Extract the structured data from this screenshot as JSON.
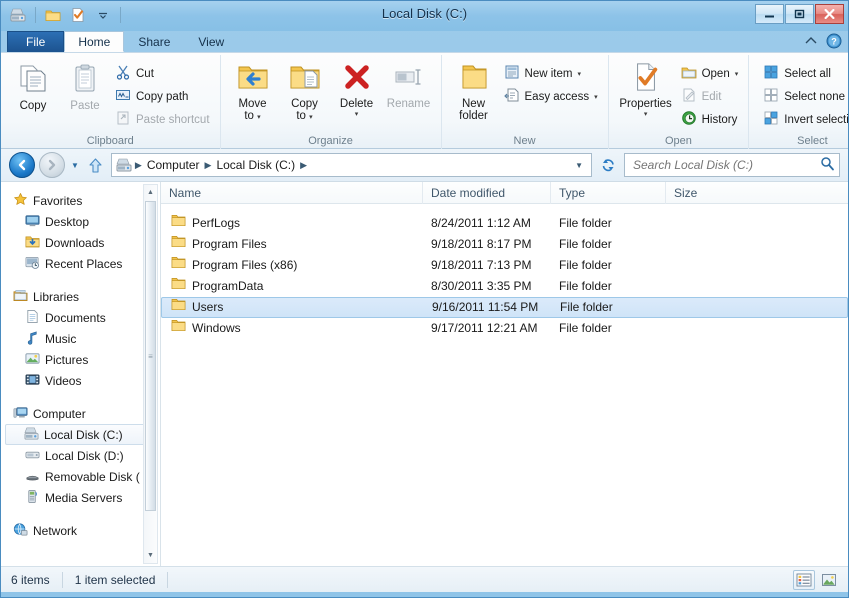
{
  "window": {
    "title": "Local Disk (C:)",
    "controls": {
      "minimize": "–",
      "restore": "❐",
      "close": "✕"
    },
    "quick_access": [
      "drive-icon",
      "folder-icon",
      "properties-icon",
      "customize-dropdown-icon"
    ]
  },
  "ribbon": {
    "tabs": [
      {
        "label": "File",
        "active": false,
        "file": true
      },
      {
        "label": "Home",
        "active": true
      },
      {
        "label": "Share",
        "active": false
      },
      {
        "label": "View",
        "active": false
      }
    ],
    "corner": {
      "collapse": "collapse-ribbon-icon",
      "help": "?"
    },
    "groups": [
      {
        "label": "Clipboard",
        "big": [
          {
            "label": "Copy",
            "icon": "copy-icon",
            "disabled": false
          },
          {
            "label": "Paste",
            "icon": "paste-icon",
            "disabled": true
          }
        ],
        "small": [
          {
            "label": "Cut",
            "icon": "cut-icon",
            "disabled": false
          },
          {
            "label": "Copy path",
            "icon": "copy-path-icon",
            "disabled": false
          },
          {
            "label": "Paste shortcut",
            "icon": "paste-shortcut-icon",
            "disabled": true
          }
        ]
      },
      {
        "label": "Organize",
        "big": [
          {
            "label": "Move",
            "label2": "to",
            "icon": "move-to-icon",
            "dropdown": true,
            "disabled": false
          },
          {
            "label": "Copy",
            "label2": "to",
            "icon": "copy-to-icon",
            "dropdown": true,
            "disabled": false
          },
          {
            "label": "Delete",
            "icon": "delete-icon",
            "dropdown": true,
            "disabled": false
          },
          {
            "label": "Rename",
            "icon": "rename-icon",
            "disabled": true
          }
        ]
      },
      {
        "label": "New",
        "big": [
          {
            "label": "New",
            "label2": "folder",
            "icon": "new-folder-icon",
            "disabled": false
          }
        ],
        "small": [
          {
            "label": "New item",
            "icon": "new-item-icon",
            "dropdown": true,
            "disabled": false
          },
          {
            "label": "Easy access",
            "icon": "easy-access-icon",
            "dropdown": true,
            "disabled": false
          }
        ]
      },
      {
        "label": "Open",
        "big": [
          {
            "label": "Properties",
            "icon": "properties-icon",
            "dropdown": true,
            "disabled": false
          }
        ],
        "small": [
          {
            "label": "Open",
            "icon": "open-icon",
            "dropdown": true,
            "disabled": false
          },
          {
            "label": "Edit",
            "icon": "edit-icon",
            "disabled": true
          },
          {
            "label": "History",
            "icon": "history-icon",
            "disabled": false
          }
        ]
      },
      {
        "label": "Select",
        "small": [
          {
            "label": "Select all",
            "icon": "select-all-icon",
            "disabled": false
          },
          {
            "label": "Select none",
            "icon": "select-none-icon",
            "disabled": false
          },
          {
            "label": "Invert selection",
            "icon": "invert-selection-icon",
            "disabled": false
          }
        ]
      }
    ]
  },
  "address": {
    "back": "back-arrow-icon",
    "forward": "forward-arrow-icon",
    "recent_dropdown": "▼",
    "up": "up-arrow-icon",
    "location_icon": "drive-icon",
    "breadcrumbs": [
      "Computer",
      "Local Disk (C:)"
    ],
    "breadcrumb_sep": "▶",
    "dropdown": "▼",
    "refresh": "refresh-icon"
  },
  "search": {
    "placeholder": "Search Local Disk (C:)",
    "value": "",
    "icon": "search-icon"
  },
  "navpane": {
    "sections": [
      {
        "header": {
          "label": "Favorites",
          "icon": "star-icon"
        },
        "items": [
          {
            "label": "Desktop",
            "icon": "desktop-icon"
          },
          {
            "label": "Downloads",
            "icon": "downloads-icon"
          },
          {
            "label": "Recent Places",
            "icon": "recent-places-icon"
          }
        ]
      },
      {
        "header": {
          "label": "Libraries",
          "icon": "libraries-icon"
        },
        "items": [
          {
            "label": "Documents",
            "icon": "documents-icon"
          },
          {
            "label": "Music",
            "icon": "music-icon"
          },
          {
            "label": "Pictures",
            "icon": "pictures-icon"
          },
          {
            "label": "Videos",
            "icon": "videos-icon"
          }
        ]
      },
      {
        "header": {
          "label": "Computer",
          "icon": "computer-icon"
        },
        "items": [
          {
            "label": "Local Disk (C:)",
            "icon": "local-disk-c-icon",
            "selected": true
          },
          {
            "label": "Local Disk (D:)",
            "icon": "local-disk-d-icon"
          },
          {
            "label": "Removable Disk (",
            "icon": "removable-disk-icon"
          },
          {
            "label": "Media Servers",
            "icon": "media-servers-icon"
          }
        ]
      },
      {
        "header": {
          "label": "Network",
          "icon": "network-icon"
        },
        "items": []
      }
    ]
  },
  "filelist": {
    "columns": [
      "Name",
      "Date modified",
      "Type",
      "Size"
    ],
    "rows": [
      {
        "name": "PerfLogs",
        "date": "8/24/2011 1:12 AM",
        "type": "File folder",
        "size": "",
        "selected": false
      },
      {
        "name": "Program Files",
        "date": "9/18/2011 8:17 PM",
        "type": "File folder",
        "size": "",
        "selected": false
      },
      {
        "name": "Program Files (x86)",
        "date": "9/18/2011 7:13 PM",
        "type": "File folder",
        "size": "",
        "selected": false
      },
      {
        "name": "ProgramData",
        "date": "8/30/2011 3:35 PM",
        "type": "File folder",
        "size": "",
        "selected": false
      },
      {
        "name": "Users",
        "date": "9/16/2011 11:54 PM",
        "type": "File folder",
        "size": "",
        "selected": true
      },
      {
        "name": "Windows",
        "date": "9/17/2011 12:21 AM",
        "type": "File folder",
        "size": "",
        "selected": false
      }
    ]
  },
  "statusbar": {
    "item_count": "6 items",
    "selection": "1 item selected",
    "views": [
      {
        "name": "details-view",
        "active": true
      },
      {
        "name": "large-icons-view",
        "active": false
      }
    ]
  },
  "colors": {
    "titlebar": "#8fc4e8",
    "accent": "#1b78c8",
    "selection": "#cfe4f8",
    "folder": "#f4c94b",
    "close": "#d9615a"
  }
}
